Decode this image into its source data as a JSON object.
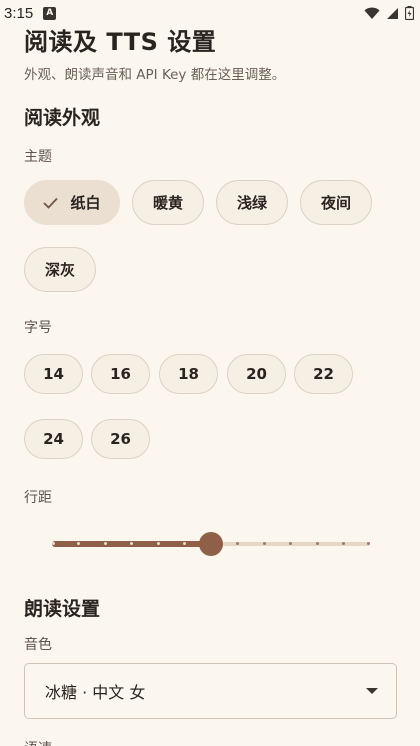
{
  "status": {
    "time": "3:15",
    "notif": "A"
  },
  "header": {
    "title": "阅读及 TTS 设置",
    "subtitle": "外观、朗读声音和 API Key 都在这里调整。"
  },
  "appearance": {
    "section_title": "阅读外观",
    "theme_label": "主题",
    "themes": [
      "纸白",
      "暖黄",
      "浅绿",
      "夜间",
      "深灰"
    ],
    "selected_theme": "纸白",
    "font_size_label": "字号",
    "font_sizes": [
      "14",
      "16",
      "18",
      "20",
      "22",
      "24",
      "26"
    ],
    "line_spacing_label": "行距",
    "line_spacing_step": 6,
    "line_spacing_steps_total": 12
  },
  "tts": {
    "section_title": "朗读设置",
    "voice_label": "音色",
    "voice_value": "冰糖 · 中文 女",
    "next_label": "语速"
  },
  "colors": {
    "background": "#fcf7ee",
    "accent": "#8f5f47",
    "chip_selected": "#ebdfd2"
  }
}
